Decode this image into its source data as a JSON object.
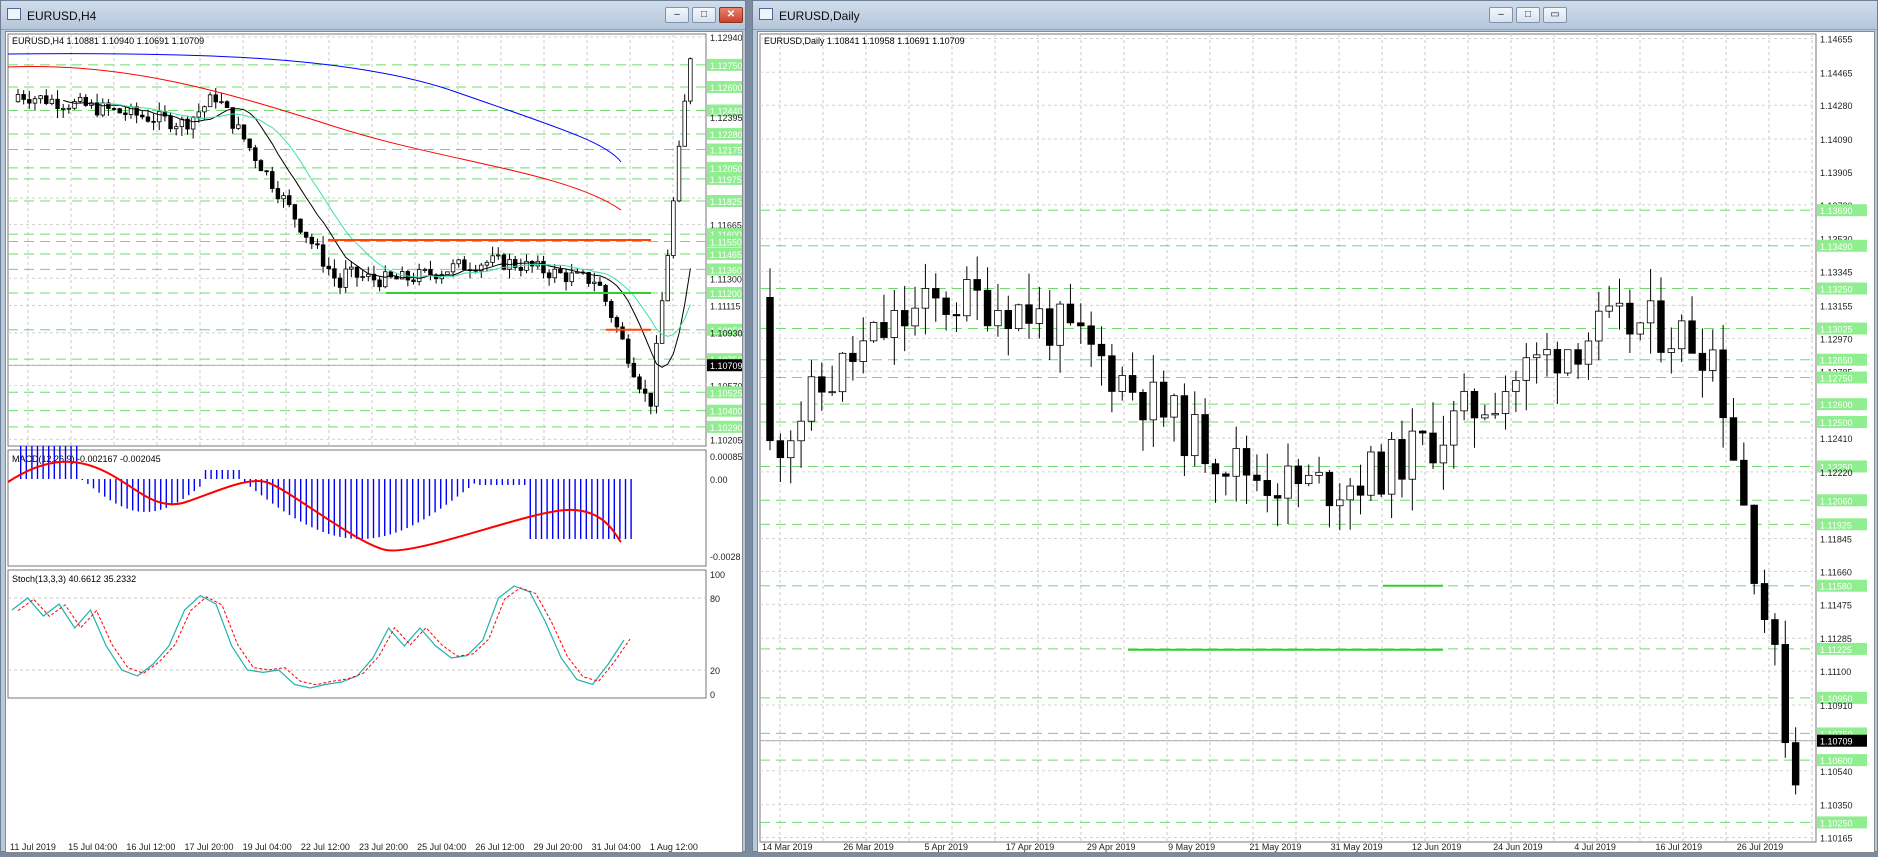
{
  "left_window": {
    "title": "EURUSD,H4",
    "price_header": "EURUSD,H4  1.10881 1.10940 1.10691 1.10709",
    "macd_label": "MACD(12,26,9) -0.002167 -0.002045",
    "stoch_label": "Stoch(13,3,3) 40.6612 35.2332",
    "price_axis": [
      "1.12940",
      "1.12750",
      "1.12600",
      "1.12440",
      "1.12395",
      "1.12280",
      "1.12175",
      "1.12050",
      "1.11975",
      "1.11845",
      "1.11825",
      "1.11665",
      "1.11600",
      "1.11550",
      "1.11465",
      "1.11360",
      "1.11300",
      "1.11200",
      "1.11115",
      "1.10950",
      "1.10930",
      "1.10750",
      "1.10709",
      "1.10570",
      "1.10525",
      "1.10400",
      "1.10290",
      "1.10205"
    ],
    "current_price": "1.10709",
    "macd_axis": [
      "0.000851",
      "0.00",
      "-0.0028"
    ],
    "stoch_axis": [
      "100",
      "80",
      "20",
      "0"
    ],
    "time_axis": [
      "11 Jul 2019",
      "15 Jul 04:00",
      "16 Jul 12:00",
      "17 Jul 20:00",
      "19 Jul 04:00",
      "22 Jul 12:00",
      "23 Jul 20:00",
      "25 Jul 04:00",
      "26 Jul 12:00",
      "29 Jul 20:00",
      "31 Jul 04:00",
      "1 Aug 12:00"
    ]
  },
  "right_window": {
    "title": "EURUSD,Daily",
    "price_header": "EURUSD,Daily  1.10841 1.10958 1.10691 1.10709",
    "price_axis": [
      "1.14655",
      "1.14465",
      "1.14280",
      "1.14090",
      "1.13905",
      "1.13720",
      "1.13690",
      "1.13530",
      "1.13490",
      "1.13345",
      "1.13250",
      "1.13155",
      "1.13025",
      "1.12970",
      "1.12850",
      "1.12785",
      "1.12750",
      "1.12600",
      "1.12500",
      "1.12410",
      "1.12250",
      "1.12220",
      "1.12060",
      "1.11925",
      "1.11845",
      "1.11660",
      "1.11580",
      "1.11475",
      "1.11285",
      "1.11225",
      "1.11100",
      "1.10950",
      "1.10910",
      "1.10750",
      "1.10709",
      "1.10600",
      "1.10540",
      "1.10350",
      "1.10250",
      "1.10165"
    ],
    "current_price": "1.10709",
    "time_axis": [
      "14 Mar 2019",
      "26 Mar 2019",
      "5 Apr 2019",
      "17 Apr 2019",
      "29 Apr 2019",
      "9 May 2019",
      "21 May 2019",
      "31 May 2019",
      "12 Jun 2019",
      "24 Jun 2019",
      "4 Jul 2019",
      "16 Jul 2019",
      "26 Jul 2019"
    ]
  },
  "colors": {
    "bull_candle": "#ffffff",
    "bear_candle": "#000000",
    "resistance_line": "#ff4500",
    "support_line": "#32cd32",
    "level_tag": "#90ee90",
    "ma_blue": "#0000ff",
    "ma_red": "#ff0000",
    "ma_green": "#40e0a0",
    "ma_black": "#000000",
    "macd_hist": "#0000ff",
    "macd_signal": "#ff0000",
    "stoch_main": "#20b2aa",
    "stoch_signal": "#ff0000"
  }
}
